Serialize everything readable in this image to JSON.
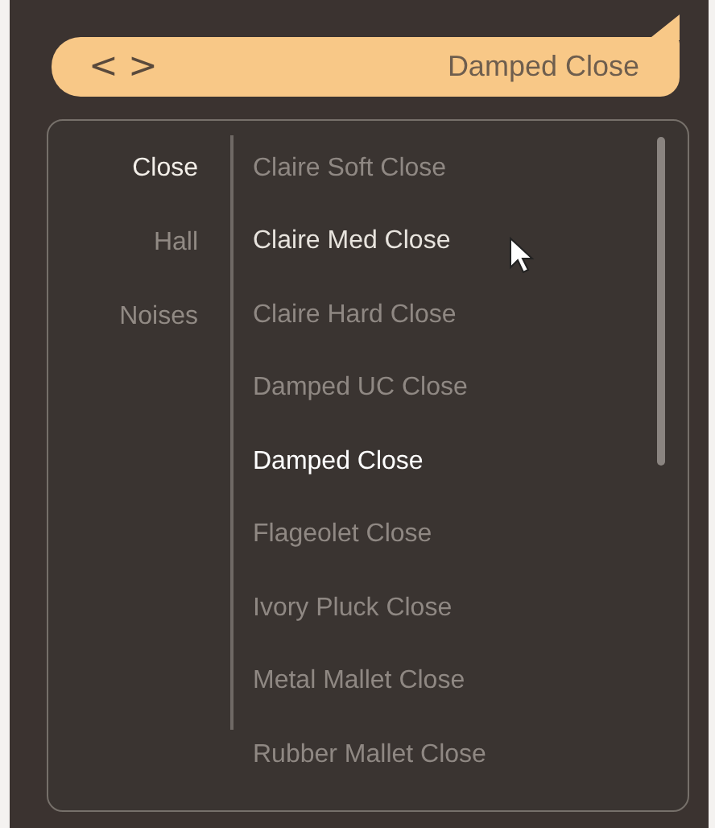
{
  "header": {
    "prev": "<",
    "next": ">",
    "title": "Damped Close"
  },
  "categories": [
    {
      "label": "Close",
      "selected": true
    },
    {
      "label": "Hall",
      "selected": false
    },
    {
      "label": "Noises",
      "selected": false
    }
  ],
  "presets": [
    {
      "label": "Claire Soft Close",
      "selected": false,
      "hovered": false
    },
    {
      "label": "Claire Med Close",
      "selected": false,
      "hovered": true
    },
    {
      "label": "Claire Hard Close",
      "selected": false,
      "hovered": false
    },
    {
      "label": "Damped UC Close",
      "selected": false,
      "hovered": false
    },
    {
      "label": "Damped Close",
      "selected": true,
      "hovered": false
    },
    {
      "label": "Flageolet Close",
      "selected": false,
      "hovered": false
    },
    {
      "label": "Ivory Pluck Close",
      "selected": false,
      "hovered": false
    },
    {
      "label": "Metal Mallet Close",
      "selected": false,
      "hovered": false
    },
    {
      "label": "Rubber Mallet Close",
      "selected": false,
      "hovered": false
    }
  ]
}
